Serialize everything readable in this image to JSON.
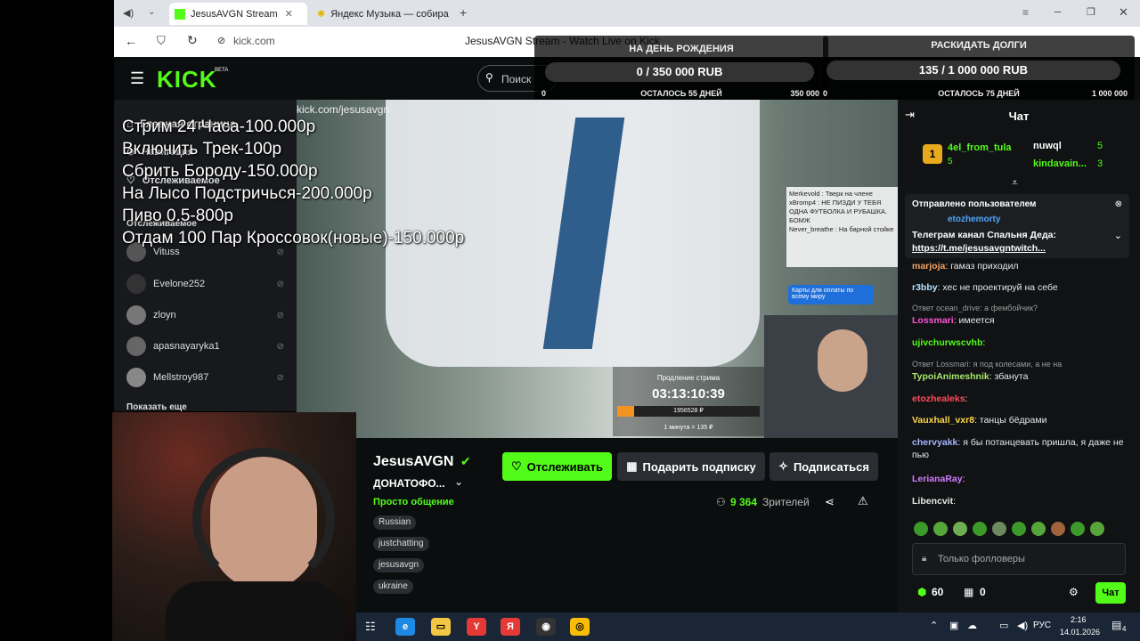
{
  "browser": {
    "tabs": [
      {
        "title": "JesusAVGN Stream"
      },
      {
        "title": "Яндекс Музыка — собира"
      }
    ],
    "url": "kick.com",
    "page_title": "JesusAVGN Stream - Watch Live on Kick"
  },
  "kick": {
    "logo": "KICK",
    "logo_badge": "BETA",
    "search_placeholder": "Поиск"
  },
  "goals": {
    "left": {
      "title": "НА ДЕНЬ РОЖДЕНИЯ",
      "progress": "0 / 350 000 RUB",
      "remaining": "ОСТАЛОСЬ 55 ДНЕЙ",
      "min": "0",
      "max": "350 000",
      "fill": 0
    },
    "right": {
      "title": "РАСКИДАТЬ ДОЛГИ",
      "progress": "135 / 1 000 000 RUB",
      "remaining": "ОСТАЛОСЬ 75 ДНЕЙ",
      "min": "0",
      "max": "1 000 000",
      "fill": 0.0001
    }
  },
  "sidebar": {
    "home": "Главная страница",
    "nav": "Навигация",
    "following": "Отслеживаемое",
    "following2": "Отслеживаемое",
    "channels": [
      "Vituss",
      "Evelone252",
      "zloyn",
      "apasnayaryka1",
      "Mellstroy987"
    ],
    "show_more": "Показать еще"
  },
  "overlay_text": [
    "Стрим 24 Часа-100.000р",
    "Включить Трек-100р",
    "Сбрить Бороду-150.000р",
    "На Лысо Подстричься-200.000р",
    "Пиво 0.5-800р",
    "Отдам 100 Пар Кроссовок(новые)-150.000р"
  ],
  "video": {
    "watermark": "kick.com/jesusavgn",
    "timer_label": "Продление стрима",
    "timer": "03:13:10:39",
    "timer_amount": "1956528 ₽",
    "timer_rate": "1 минута = 135 ₽",
    "timer_fill": 0.12,
    "card_banner": "Карты для оплаты по всему миру",
    "mini_chat": [
      "Merkevold : Тверк на члене",
      "xBromp4 : НЕ ПИЗДИ У ТЕБЯ ОДНА ФУТБОЛКА И РУБАШКА. БОМЖ",
      "Never_breathe : На барной стойке"
    ]
  },
  "channel": {
    "name": "JesusAVGN",
    "title": "ДОНАТОФО...",
    "category": "Просто общение",
    "tags": [
      "Russian",
      "justchatting",
      "jesusavgn",
      "ukraine"
    ],
    "follow": "Отслеживать",
    "gift": "Подарить подписку",
    "subscribe": "Подписаться",
    "viewers": "9 364",
    "viewers_label": "Зрителей"
  },
  "chat": {
    "title": "Чат",
    "leaders": [
      {
        "name": "4el_from_tula",
        "count": "5"
      },
      {
        "name": "nuwql",
        "count": "5"
      },
      {
        "name": "kindavain...",
        "count": "3"
      }
    ],
    "pinned_by": "Отправлено пользователем",
    "pinned_user": "etozhemorty",
    "pinned_text": "Телеграм канал Спальня Деда:",
    "pinned_link": "https://t.me/jesusavgntwitch...",
    "messages": [
      {
        "user": "marjoja",
        "text": ": гамаз приходил"
      },
      {
        "user": "r3bby",
        "text": ": хес не проектируй на себе"
      },
      {
        "reply": "Ответ ocean_drive: а фембойчик?"
      },
      {
        "user": "Lossmari",
        "text": ": имеется"
      },
      {
        "user": "ujivchurwscvhb",
        "text": ":"
      },
      {
        "reply": "Ответ Lossmari: я под колесами, а не на"
      },
      {
        "user": "TypoiAnimeshnik",
        "text": ": збанута"
      },
      {
        "user": "etozhealeks",
        "text": ":"
      },
      {
        "user": "Vauxhall_vxr8",
        "text": ": танцы бёдрами"
      },
      {
        "user": "chervyakk",
        "text": ": я бы потанцевать пришла, я даже не пью"
      },
      {
        "user": "LerianaRay",
        "text": ":"
      },
      {
        "user": "Libencvit",
        "text": ":"
      }
    ],
    "input_placeholder": "Только фолловеры",
    "points": "60",
    "gifts": "0",
    "send": "Чат"
  },
  "taskbar": {
    "lang": "РУС",
    "time": "2:16",
    "date": "14.01.2026",
    "notifications": "4"
  },
  "colors": {
    "kick_green": "#53fc18",
    "goal_right": "#e5393b"
  }
}
